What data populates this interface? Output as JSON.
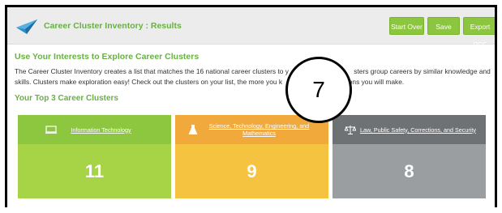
{
  "header": {
    "title": "Career Cluster Inventory : Results",
    "logo_icon": "paper-plane-icon",
    "buttons": [
      {
        "label": "Start Over"
      },
      {
        "label": "Save"
      },
      {
        "label": "Export PDF"
      }
    ]
  },
  "intro": {
    "heading": "Use Your Interests to Explore Career Clusters",
    "line1_start": "The Career Cluster Inventory creates a list that matches the 16 national career clusters to y",
    "line1_end": "sters group careers by similar knowledge and",
    "line2_start": "skills. Clusters make exploration easy! Check out the clusters on your list, the more you k",
    "line2_end": "decisions you will make."
  },
  "top_clusters": {
    "heading": "Your Top 3 Career Clusters",
    "cards": [
      {
        "title": "Information Technology",
        "score": "11",
        "icon": "monitor-icon",
        "color": "#8dc63f"
      },
      {
        "title": "Science, Technology, Engineering, and Mathematics",
        "score": "9",
        "icon": "flask-icon",
        "color": "#f2a93b"
      },
      {
        "title": "Law, Public Safety, Corrections, and Security",
        "score": "8",
        "icon": "scales-icon",
        "color": "#6f7275"
      }
    ]
  },
  "overlay": {
    "step_number": "7"
  },
  "colors": {
    "accent": "#69b042",
    "button": "#8cc63f"
  }
}
